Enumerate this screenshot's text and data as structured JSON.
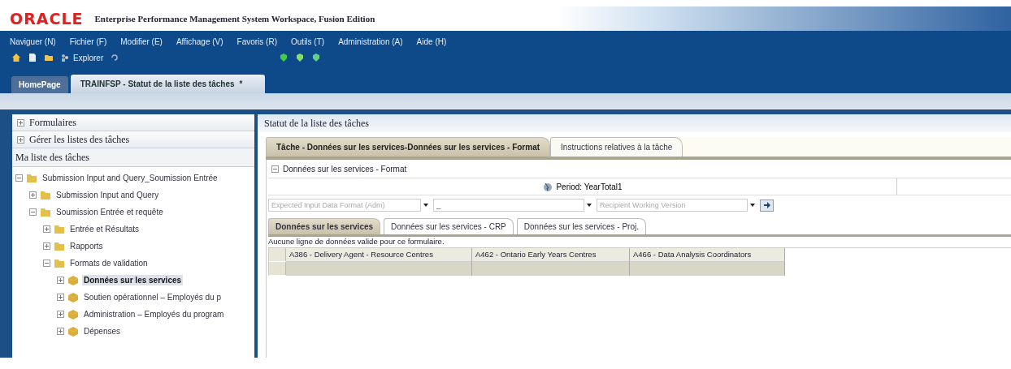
{
  "header": {
    "logo": "ORACLE",
    "title": "Enterprise Performance Management System Workspace, Fusion Edition"
  },
  "menu": [
    "Naviguer (N)",
    "Fichier (F)",
    "Modifier (E)",
    "Affichage (V)",
    "Favoris (R)",
    "Outils (T)",
    "Administration (A)",
    "Aide (H)"
  ],
  "toolbar": {
    "explorer": "Explorer"
  },
  "doc_tabs": [
    {
      "label": "HomePage",
      "selected": false
    },
    {
      "label": "TRAINFSP - Statut de la liste des tâches",
      "selected": true,
      "close": "*"
    }
  ],
  "left_panel": {
    "sections": [
      {
        "label": "Formulaires",
        "expanded": false
      },
      {
        "label": "Gérer les listes des tâches",
        "expanded": false
      }
    ],
    "title": "Ma liste des tâches",
    "tree": [
      {
        "label": "Submission Input and Query_Soumission Entrée",
        "kind": "folder",
        "expanded": true,
        "selected": false,
        "children": [
          {
            "label": "Submission Input and Query",
            "kind": "folder",
            "expanded": false,
            "selected": false
          },
          {
            "label": "Soumission Entrée et requête",
            "kind": "folder",
            "expanded": true,
            "selected": false,
            "children": [
              {
                "label": "Entrée et Résultats",
                "kind": "folder",
                "expanded": false,
                "selected": false
              },
              {
                "label": "Rapports",
                "kind": "folder",
                "expanded": false,
                "selected": false
              },
              {
                "label": "Formats de validation",
                "kind": "folder",
                "expanded": true,
                "selected": false,
                "children": [
                  {
                    "label": "Données sur les services",
                    "kind": "form",
                    "expanded": false,
                    "selected": true
                  },
                  {
                    "label": "Soutien opérationnel – Employés du p",
                    "kind": "form",
                    "expanded": false,
                    "selected": false
                  },
                  {
                    "label": "Administration – Employés du program",
                    "kind": "form",
                    "expanded": false,
                    "selected": false
                  },
                  {
                    "label": "Dépenses",
                    "kind": "form",
                    "expanded": false,
                    "selected": false
                  }
                ]
              }
            ]
          }
        ]
      }
    ]
  },
  "main": {
    "title": "Statut de la liste des tâches",
    "tabs": [
      {
        "label": "Tâche - Données sur les services-Données sur les services - Format",
        "selected": true
      },
      {
        "label": "Instructions relatives à la tâche",
        "selected": false
      }
    ],
    "section": "Données sur les services - Format",
    "pov": "Period: YearTotal1",
    "selectors": [
      {
        "placeholder": "Expected Input Data Format (Adm)"
      },
      {
        "value": "_"
      },
      {
        "placeholder": "Recipient Working Version"
      }
    ],
    "form_tabs": [
      {
        "label": "Données sur les services",
        "selected": true
      },
      {
        "label": "Données sur les services - CRP",
        "selected": false
      },
      {
        "label": "Données sur les services - Proj.",
        "selected": false
      }
    ],
    "message": "Aucune ligne de données valide pour ce formulaire.",
    "columns": [
      "A386 - Delivery Agent - Resource Centres",
      "A462 - Ontario Early Years Centres",
      "A466 - Data Analysis Coordinators"
    ]
  }
}
